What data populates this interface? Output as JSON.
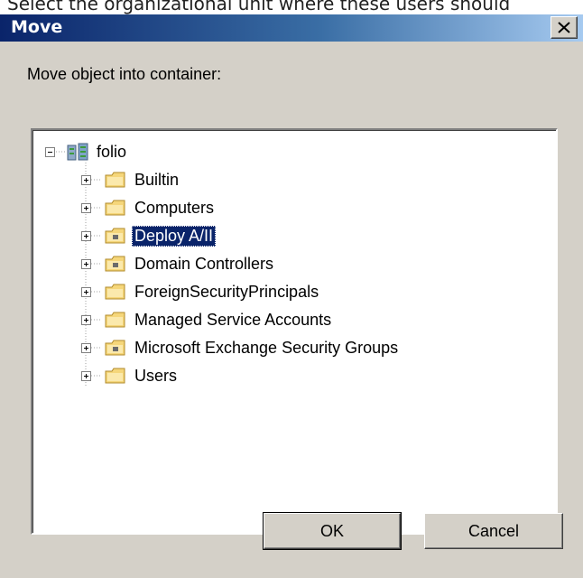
{
  "background_text": "Select the organizational unit where these users should",
  "window": {
    "title": "Move"
  },
  "prompt": "Move object into container:",
  "tree": {
    "root": {
      "label": "folio",
      "icon": "domain-icon"
    },
    "children": [
      {
        "label": "Builtin",
        "icon": "folder-icon"
      },
      {
        "label": "Computers",
        "icon": "folder-icon"
      },
      {
        "label": "Deploy A/II",
        "icon": "ou-folder-icon",
        "selected": true
      },
      {
        "label": "Domain Controllers",
        "icon": "ou-folder-icon"
      },
      {
        "label": "ForeignSecurityPrincipals",
        "icon": "folder-icon"
      },
      {
        "label": "Managed Service Accounts",
        "icon": "folder-icon"
      },
      {
        "label": "Microsoft Exchange Security Groups",
        "icon": "ou-folder-icon"
      },
      {
        "label": "Users",
        "icon": "folder-icon"
      }
    ]
  },
  "buttons": {
    "ok": "OK",
    "cancel": "Cancel"
  },
  "colors": {
    "selection": "#0a246a",
    "titlebar": "#0a246a",
    "folder": "#f5d67a"
  }
}
